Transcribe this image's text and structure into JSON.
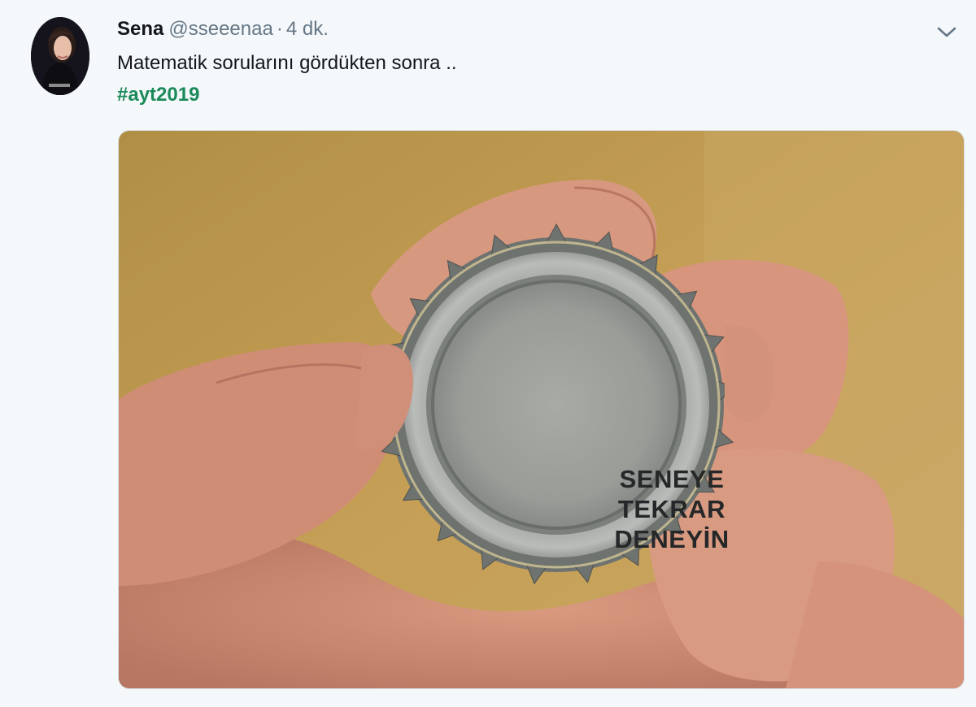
{
  "tweet": {
    "author_name": "Sena",
    "handle": "@sseeenaa",
    "separator": "·",
    "time": "4 dk.",
    "text": "Matematik sorularını gördükten sonra ..",
    "hashtag": "#ayt2019"
  },
  "media": {
    "cap_lines": [
      "SENEYE",
      "TEKRAR",
      "DENEYİN"
    ]
  },
  "icons": {
    "menu": "chevron-down-icon"
  },
  "colors": {
    "background": "#f5f8fa",
    "hashtag": "#1b8a5a",
    "secondary_text": "#657786"
  }
}
